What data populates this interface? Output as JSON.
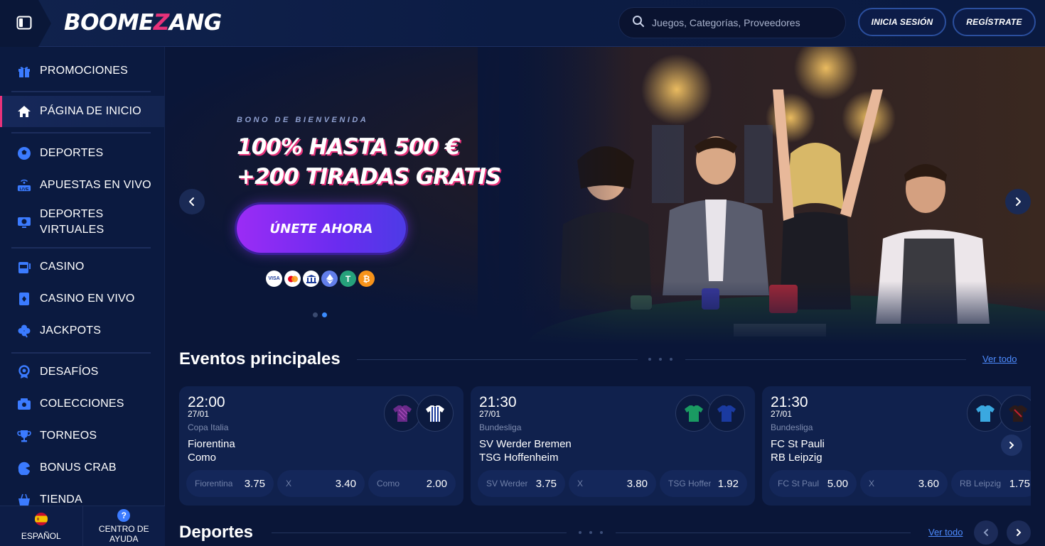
{
  "header": {
    "logo_text_a": "BOOME",
    "logo_text_z": "Z",
    "logo_text_b": "ANG",
    "search_placeholder": "Juegos, Categorías, Proveedores",
    "login_label": "INICIA SESIÓN",
    "register_label": "REGÍSTRATE"
  },
  "sidebar": {
    "items": [
      {
        "label": "PROMOCIONES",
        "icon": "gift-icon"
      },
      {
        "label": "PÁGINA DE INICIO",
        "icon": "home-icon"
      },
      {
        "label": "DEPORTES",
        "icon": "soccer-ball-icon"
      },
      {
        "label": "APUESTAS EN VIVO",
        "icon": "live-icon"
      },
      {
        "label": "DEPORTES\nVIRTUALES",
        "icon": "virtual-sports-icon"
      },
      {
        "label": "CASINO",
        "icon": "slot-machine-icon"
      },
      {
        "label": "CASINO EN VIVO",
        "icon": "live-casino-icon"
      },
      {
        "label": "JACKPOTS",
        "icon": "clover-icon"
      },
      {
        "label": "DESAFÍOS",
        "icon": "medal-icon"
      },
      {
        "label": "COLECCIONES",
        "icon": "collections-icon"
      },
      {
        "label": "TORNEOS",
        "icon": "trophy-icon"
      },
      {
        "label": "BONUS CRAB",
        "icon": "crab-icon"
      },
      {
        "label": "TIENDA",
        "icon": "shop-icon"
      }
    ],
    "language_label": "ESPAÑOL",
    "help_label": "CENTRO DE AYUDA"
  },
  "hero": {
    "eyebrow": "BONO DE BIENVENIDA",
    "title_line1": "100% HASTA 500 €",
    "title_line2": "+200 TIRADAS GRATIS",
    "cta_label": "ÚNETE AHORA",
    "payment_methods": [
      "VISA",
      "Mastercard",
      "Bank",
      "Ethereum",
      "Tether",
      "Bitcoin"
    ],
    "slide_count": 2,
    "active_slide": 2
  },
  "events": {
    "title": "Eventos principales",
    "see_all": "Ver todo",
    "cards": [
      {
        "time": "22:00",
        "date": "27/01",
        "league": "Copa Italia",
        "home": "Fiorentina",
        "away": "Como",
        "odds": [
          {
            "label": "Fiorentina",
            "value": "3.75"
          },
          {
            "label": "X",
            "value": "3.40"
          },
          {
            "label": "Como",
            "value": "2.00"
          }
        ],
        "colors": [
          "#5a2a8a",
          "#ffffff"
        ]
      },
      {
        "time": "21:30",
        "date": "27/01",
        "league": "Bundesliga",
        "home": "SV Werder Bremen",
        "away": "TSG Hoffenheim",
        "odds": [
          {
            "label": "SV Werder",
            "value": "3.75"
          },
          {
            "label": "X",
            "value": "3.80"
          },
          {
            "label": "TSG Hoffer",
            "value": "1.92"
          }
        ],
        "colors": [
          "#1a8a5a",
          "#1a3a9a"
        ]
      },
      {
        "time": "21:30",
        "date": "27/01",
        "league": "Bundesliga",
        "home": "FC St Pauli",
        "away": "RB Leipzig",
        "odds": [
          {
            "label": "FC St Paul",
            "value": "5.00"
          },
          {
            "label": "X",
            "value": "3.60"
          },
          {
            "label": "RB Leipzig",
            "value": "1.75"
          }
        ],
        "colors": [
          "#3aa8e0",
          "#2a1a1a"
        ]
      }
    ]
  },
  "sports": {
    "title": "Deportes",
    "see_all": "Ver todo"
  },
  "colors": {
    "accent": "#e8327a",
    "link": "#4d8cff",
    "cta": "#7a2cf2"
  }
}
